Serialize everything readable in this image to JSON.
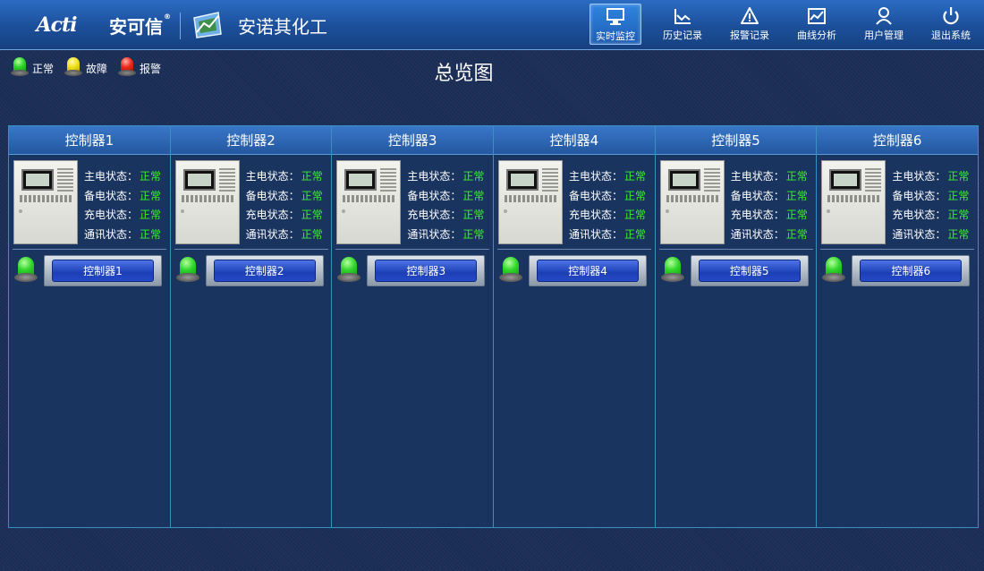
{
  "header": {
    "logo_en": "Acti",
    "logo_cn": "安可信",
    "logo_reg": "®",
    "company": "安诺其化工"
  },
  "nav": [
    {
      "label": "实时监控",
      "icon": "monitor-icon",
      "active": true
    },
    {
      "label": "历史记录",
      "icon": "chart-icon",
      "active": false
    },
    {
      "label": "报警记录",
      "icon": "warning-icon",
      "active": false
    },
    {
      "label": "曲线分析",
      "icon": "trend-icon",
      "active": false
    },
    {
      "label": "用户管理",
      "icon": "user-icon",
      "active": false
    },
    {
      "label": "退出系统",
      "icon": "power-icon",
      "active": false
    }
  ],
  "legend": [
    {
      "label": "正常",
      "color": "green"
    },
    {
      "label": "故障",
      "color": "yellow"
    },
    {
      "label": "报警",
      "color": "red"
    }
  ],
  "page_title": "总览图",
  "status_labels": {
    "main_power": "主电状态：",
    "backup_power": "备电状态：",
    "charging": "充电状态：",
    "comm": "通讯状态："
  },
  "controllers": [
    {
      "title": "控制器1",
      "button": "控制器1",
      "main_power": "正常",
      "backup_power": "正常",
      "charging": "正常",
      "comm": "正常",
      "lamp": "green"
    },
    {
      "title": "控制器2",
      "button": "控制器2",
      "main_power": "正常",
      "backup_power": "正常",
      "charging": "正常",
      "comm": "正常",
      "lamp": "green"
    },
    {
      "title": "控制器3",
      "button": "控制器3",
      "main_power": "正常",
      "backup_power": "正常",
      "charging": "正常",
      "comm": "正常",
      "lamp": "green"
    },
    {
      "title": "控制器4",
      "button": "控制器4",
      "main_power": "正常",
      "backup_power": "正常",
      "charging": "正常",
      "comm": "正常",
      "lamp": "green"
    },
    {
      "title": "控制器5",
      "button": "控制器5",
      "main_power": "正常",
      "backup_power": "正常",
      "charging": "正常",
      "comm": "正常",
      "lamp": "green"
    },
    {
      "title": "控制器6",
      "button": "控制器6",
      "main_power": "正常",
      "backup_power": "正常",
      "charging": "正常",
      "comm": "正常",
      "lamp": "green"
    }
  ],
  "colors": {
    "header_top": "#2a6cc2",
    "panel_border": "#3a8fc1",
    "status_ok": "#3bf12a",
    "button_blue": "#1c3fb6"
  }
}
